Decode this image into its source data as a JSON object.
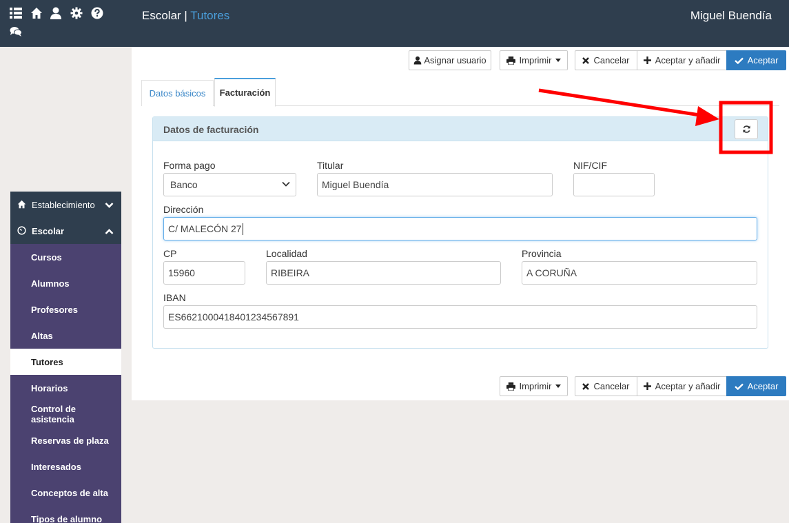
{
  "topbar": {
    "section": "Escolar",
    "separator": " | ",
    "subsection": "Tutores",
    "user": "Miguel Buendía",
    "icons": [
      "list-icon",
      "home-icon",
      "user-icon",
      "gear-icon",
      "help-icon",
      "chat-icon"
    ]
  },
  "toolbar_top": {
    "assign_user": "Asignar usuario",
    "print": "Imprimir",
    "cancel": "Cancelar",
    "accept_add": "Aceptar y añadir",
    "accept": "Aceptar"
  },
  "toolbar_bottom": {
    "print": "Imprimir",
    "cancel": "Cancelar",
    "accept_add": "Aceptar y añadir",
    "accept": "Aceptar"
  },
  "tabs": [
    {
      "label": "Datos básicos",
      "active": false
    },
    {
      "label": "Facturación",
      "active": true
    }
  ],
  "panel": {
    "title": "Datos de facturación"
  },
  "form": {
    "forma_pago": {
      "label": "Forma pago",
      "value": "Banco"
    },
    "titular": {
      "label": "Titular",
      "value": "Miguel Buendía"
    },
    "nif": {
      "label": "NIF/CIF",
      "value": ""
    },
    "direccion": {
      "label": "Dirección",
      "value": "C/ MALECÓN 27"
    },
    "cp": {
      "label": "CP",
      "value": "15960"
    },
    "localidad": {
      "label": "Localidad",
      "value": "RIBEIRA"
    },
    "provincia": {
      "label": "Provincia",
      "value": "A CORUÑA"
    },
    "iban": {
      "label": "IBAN",
      "value": "ES6621000418401234567891"
    }
  },
  "sidebar": {
    "groups": [
      {
        "label": "Establecimiento",
        "icon": "home-icon",
        "expanded": false
      },
      {
        "label": "Escolar",
        "icon": "dashboard-icon",
        "expanded": true
      }
    ],
    "items": [
      {
        "label": "Cursos"
      },
      {
        "label": "Alumnos"
      },
      {
        "label": "Profesores"
      },
      {
        "label": "Altas"
      },
      {
        "label": "Tutores",
        "active": true
      },
      {
        "label": "Horarios"
      },
      {
        "label": "Control de asistencia"
      },
      {
        "label": "Reservas de plaza"
      },
      {
        "label": "Interesados"
      },
      {
        "label": "Conceptos de alta"
      },
      {
        "label": "Tipos de alumno"
      }
    ]
  },
  "colors": {
    "topbar": "#2f3e4e",
    "sidebar": "#4b4270",
    "primary": "#2d7bc0",
    "annotation": "#ff0000"
  }
}
